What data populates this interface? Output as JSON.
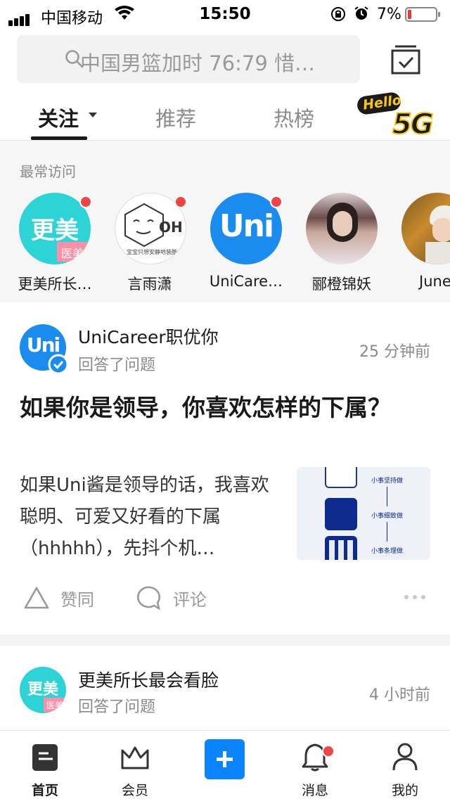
{
  "status_bar": {
    "carrier": "中国移动",
    "time": "15:50",
    "battery": "7%"
  },
  "search": {
    "placeholder": "中国男篮加时 76:79 惜…"
  },
  "tabs": [
    {
      "label": "关注"
    },
    {
      "label": "推荐"
    },
    {
      "label": "热榜"
    }
  ],
  "promo": {
    "line1": "Hello",
    "line2": "5G"
  },
  "frequent": {
    "title": "最常访问",
    "items": [
      {
        "name": "更美所长…",
        "avatar_text": "更美",
        "avatar_sub": "医美"
      },
      {
        "name": "言雨潇",
        "avatar_text": "OH",
        "avatar_sub": "宝宝只想安静地装酷"
      },
      {
        "name": "UniCare…",
        "avatar_text": "Uni"
      },
      {
        "name": "郦橙锦妖"
      },
      {
        "name": "June"
      }
    ]
  },
  "feed": [
    {
      "author": "UniCareer职优你",
      "action": "回答了问题",
      "time": "25 分钟前",
      "title": "如果你是领导，你喜欢怎样的下属？",
      "excerpt": "如果Uni酱是领导的话，我喜欢聪明、可爱又好看的下属（hhhhh），先抖个机…",
      "thumb_labels": [
        "小事坚持做",
        "小事细致做",
        "小事条理做"
      ],
      "like_label": "赞同",
      "comment_label": "评论"
    },
    {
      "author": "更美所长最会看脸",
      "action": "回答了问题",
      "time": "4 小时前",
      "avatar_text": "更美",
      "avatar_sub": "医美"
    }
  ],
  "bottom_nav": [
    {
      "label": "首页"
    },
    {
      "label": "会员"
    },
    {
      "label": ""
    },
    {
      "label": "消息"
    },
    {
      "label": "我的"
    }
  ],
  "colors": {
    "accent": "#0a84ff",
    "badge": "#f14545"
  }
}
